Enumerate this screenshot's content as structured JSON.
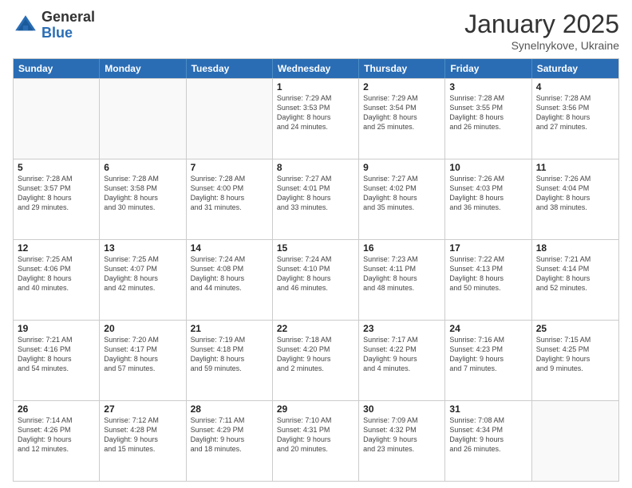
{
  "logo": {
    "general": "General",
    "blue": "Blue"
  },
  "title": "January 2025",
  "location": "Synelnykove, Ukraine",
  "days": [
    "Sunday",
    "Monday",
    "Tuesday",
    "Wednesday",
    "Thursday",
    "Friday",
    "Saturday"
  ],
  "weeks": [
    [
      {
        "day": "",
        "info": "",
        "empty": true
      },
      {
        "day": "",
        "info": "",
        "empty": true
      },
      {
        "day": "",
        "info": "",
        "empty": true
      },
      {
        "day": "1",
        "info": "Sunrise: 7:29 AM\nSunset: 3:53 PM\nDaylight: 8 hours\nand 24 minutes."
      },
      {
        "day": "2",
        "info": "Sunrise: 7:29 AM\nSunset: 3:54 PM\nDaylight: 8 hours\nand 25 minutes."
      },
      {
        "day": "3",
        "info": "Sunrise: 7:28 AM\nSunset: 3:55 PM\nDaylight: 8 hours\nand 26 minutes."
      },
      {
        "day": "4",
        "info": "Sunrise: 7:28 AM\nSunset: 3:56 PM\nDaylight: 8 hours\nand 27 minutes."
      }
    ],
    [
      {
        "day": "5",
        "info": "Sunrise: 7:28 AM\nSunset: 3:57 PM\nDaylight: 8 hours\nand 29 minutes."
      },
      {
        "day": "6",
        "info": "Sunrise: 7:28 AM\nSunset: 3:58 PM\nDaylight: 8 hours\nand 30 minutes."
      },
      {
        "day": "7",
        "info": "Sunrise: 7:28 AM\nSunset: 4:00 PM\nDaylight: 8 hours\nand 31 minutes."
      },
      {
        "day": "8",
        "info": "Sunrise: 7:27 AM\nSunset: 4:01 PM\nDaylight: 8 hours\nand 33 minutes."
      },
      {
        "day": "9",
        "info": "Sunrise: 7:27 AM\nSunset: 4:02 PM\nDaylight: 8 hours\nand 35 minutes."
      },
      {
        "day": "10",
        "info": "Sunrise: 7:26 AM\nSunset: 4:03 PM\nDaylight: 8 hours\nand 36 minutes."
      },
      {
        "day": "11",
        "info": "Sunrise: 7:26 AM\nSunset: 4:04 PM\nDaylight: 8 hours\nand 38 minutes."
      }
    ],
    [
      {
        "day": "12",
        "info": "Sunrise: 7:25 AM\nSunset: 4:06 PM\nDaylight: 8 hours\nand 40 minutes."
      },
      {
        "day": "13",
        "info": "Sunrise: 7:25 AM\nSunset: 4:07 PM\nDaylight: 8 hours\nand 42 minutes."
      },
      {
        "day": "14",
        "info": "Sunrise: 7:24 AM\nSunset: 4:08 PM\nDaylight: 8 hours\nand 44 minutes."
      },
      {
        "day": "15",
        "info": "Sunrise: 7:24 AM\nSunset: 4:10 PM\nDaylight: 8 hours\nand 46 minutes."
      },
      {
        "day": "16",
        "info": "Sunrise: 7:23 AM\nSunset: 4:11 PM\nDaylight: 8 hours\nand 48 minutes."
      },
      {
        "day": "17",
        "info": "Sunrise: 7:22 AM\nSunset: 4:13 PM\nDaylight: 8 hours\nand 50 minutes."
      },
      {
        "day": "18",
        "info": "Sunrise: 7:21 AM\nSunset: 4:14 PM\nDaylight: 8 hours\nand 52 minutes."
      }
    ],
    [
      {
        "day": "19",
        "info": "Sunrise: 7:21 AM\nSunset: 4:16 PM\nDaylight: 8 hours\nand 54 minutes."
      },
      {
        "day": "20",
        "info": "Sunrise: 7:20 AM\nSunset: 4:17 PM\nDaylight: 8 hours\nand 57 minutes."
      },
      {
        "day": "21",
        "info": "Sunrise: 7:19 AM\nSunset: 4:18 PM\nDaylight: 8 hours\nand 59 minutes."
      },
      {
        "day": "22",
        "info": "Sunrise: 7:18 AM\nSunset: 4:20 PM\nDaylight: 9 hours\nand 2 minutes."
      },
      {
        "day": "23",
        "info": "Sunrise: 7:17 AM\nSunset: 4:22 PM\nDaylight: 9 hours\nand 4 minutes."
      },
      {
        "day": "24",
        "info": "Sunrise: 7:16 AM\nSunset: 4:23 PM\nDaylight: 9 hours\nand 7 minutes."
      },
      {
        "day": "25",
        "info": "Sunrise: 7:15 AM\nSunset: 4:25 PM\nDaylight: 9 hours\nand 9 minutes."
      }
    ],
    [
      {
        "day": "26",
        "info": "Sunrise: 7:14 AM\nSunset: 4:26 PM\nDaylight: 9 hours\nand 12 minutes."
      },
      {
        "day": "27",
        "info": "Sunrise: 7:12 AM\nSunset: 4:28 PM\nDaylight: 9 hours\nand 15 minutes."
      },
      {
        "day": "28",
        "info": "Sunrise: 7:11 AM\nSunset: 4:29 PM\nDaylight: 9 hours\nand 18 minutes."
      },
      {
        "day": "29",
        "info": "Sunrise: 7:10 AM\nSunset: 4:31 PM\nDaylight: 9 hours\nand 20 minutes."
      },
      {
        "day": "30",
        "info": "Sunrise: 7:09 AM\nSunset: 4:32 PM\nDaylight: 9 hours\nand 23 minutes."
      },
      {
        "day": "31",
        "info": "Sunrise: 7:08 AM\nSunset: 4:34 PM\nDaylight: 9 hours\nand 26 minutes."
      },
      {
        "day": "",
        "info": "",
        "empty": true
      }
    ]
  ]
}
